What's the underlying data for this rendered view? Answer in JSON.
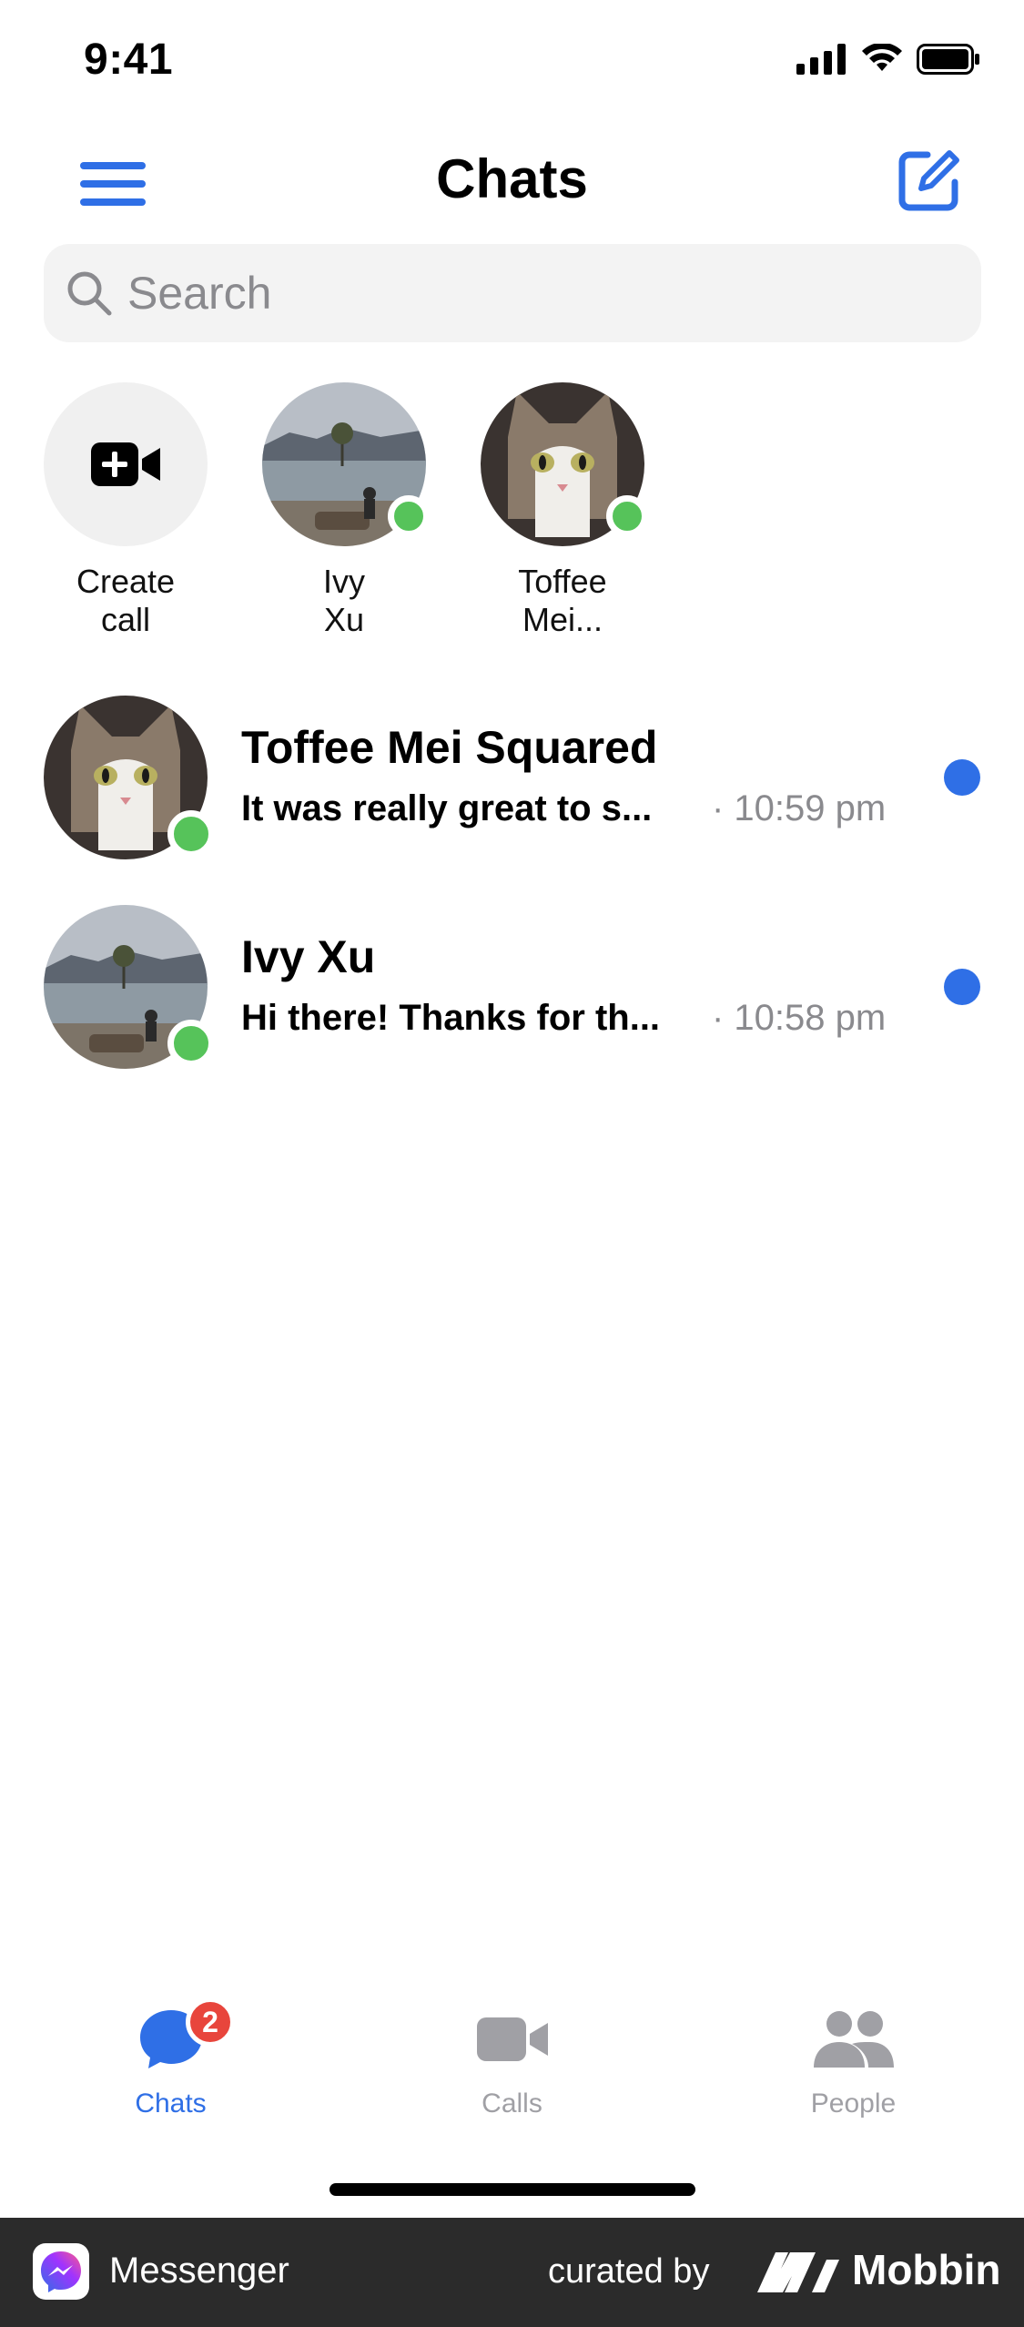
{
  "status_bar": {
    "time": "9:41"
  },
  "header": {
    "title": "Chats"
  },
  "search": {
    "placeholder": "Search"
  },
  "stories": [
    {
      "label_line1": "Create",
      "label_line2": "call",
      "icon": "video-plus-icon"
    },
    {
      "label_line1": "Ivy",
      "label_line2": "Xu",
      "online": true
    },
    {
      "label_line1": "Toffee",
      "label_line2": "Mei...",
      "online": true
    }
  ],
  "chats": [
    {
      "name": "Toffee Mei Squared",
      "preview": "It was really great to s...",
      "time": "· 10:59 pm",
      "unread": true,
      "online": true
    },
    {
      "name": "Ivy Xu",
      "preview": "Hi there! Thanks for th...",
      "time": "· 10:58 pm",
      "unread": true,
      "online": true
    }
  ],
  "tabs": [
    {
      "label": "Chats",
      "icon": "chat-bubble-icon",
      "badge": "2",
      "active": true
    },
    {
      "label": "Calls",
      "icon": "video-camera-icon",
      "active": false
    },
    {
      "label": "People",
      "icon": "people-icon",
      "active": false
    }
  ],
  "footer": {
    "app_name": "Messenger",
    "curated_by": "curated by",
    "brand": "Mobbin"
  },
  "colors": {
    "accent": "#2f6fe6",
    "online": "#56c35a",
    "badge": "#e8453c",
    "muted": "#8a8a8e"
  }
}
